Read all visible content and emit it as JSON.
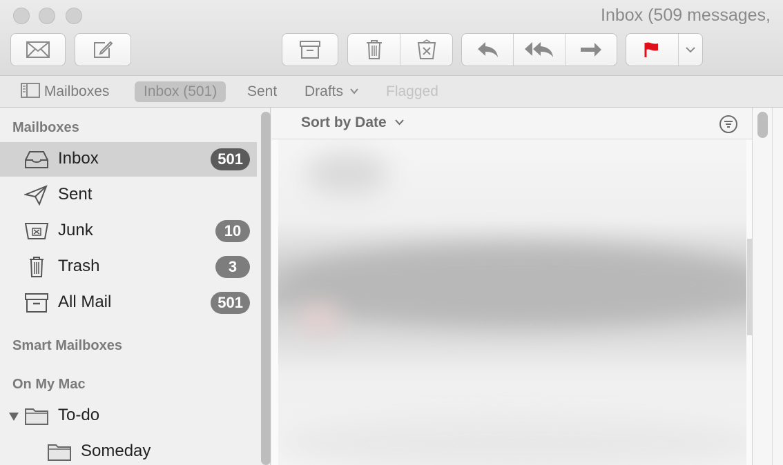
{
  "window": {
    "title": "Inbox (509 messages,"
  },
  "toolbar": {
    "get_mail": "envelope-icon",
    "compose": "compose-icon",
    "archive": "archive-icon",
    "delete": "trash-icon",
    "junk": "junk-icon",
    "reply": "reply-icon",
    "reply_all": "reply-all-icon",
    "forward": "forward-icon",
    "flag": "flag-icon",
    "flag_color": "#e0101a"
  },
  "favorites": {
    "mailboxes": "Mailboxes",
    "inbox": "Inbox (501)",
    "sent": "Sent",
    "drafts": "Drafts",
    "flagged": "Flagged"
  },
  "sidebar": {
    "mailboxes_header": "Mailboxes",
    "items": [
      {
        "label": "Inbox",
        "count": "501",
        "icon": "inbox-tray-icon"
      },
      {
        "label": "Sent",
        "count": "",
        "icon": "paper-plane-icon"
      },
      {
        "label": "Junk",
        "count": "10",
        "icon": "junk-box-icon"
      },
      {
        "label": "Trash",
        "count": "3",
        "icon": "trash-can-icon"
      },
      {
        "label": "All Mail",
        "count": "501",
        "icon": "archive-box-icon"
      }
    ],
    "smart_header": "Smart Mailboxes",
    "onmymac_header": "On My Mac",
    "folders": [
      {
        "label": "To-do",
        "icon": "folder-icon"
      },
      {
        "label": "Someday",
        "icon": "folder-icon"
      }
    ]
  },
  "message_list": {
    "sort_label": "Sort by Date"
  }
}
